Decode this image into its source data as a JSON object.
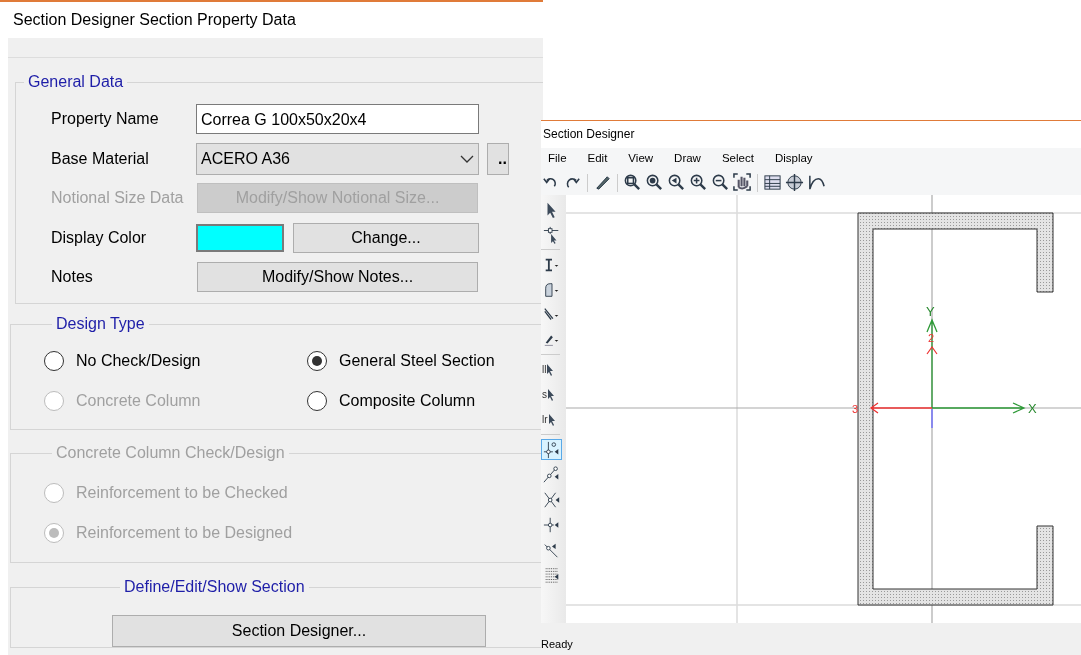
{
  "property_dialog": {
    "title": "Section Designer Section Property Data",
    "general_data": {
      "legend": "General Data",
      "rows": [
        {
          "kind": "text",
          "label": "Property Name",
          "value": "Correa G 100x50x20x4",
          "disabled": false
        },
        {
          "kind": "select",
          "label": "Base Material",
          "value": "ACERO A36",
          "disabled": false,
          "side_button": ".."
        },
        {
          "kind": "button",
          "label": "Notional Size Data",
          "button": "Modify/Show Notional Size...",
          "disabled": true
        },
        {
          "kind": "color",
          "label": "Display Color",
          "color": "#00ffff",
          "button": "Change...",
          "disabled": false
        },
        {
          "kind": "button",
          "label": "Notes",
          "button": "Modify/Show Notes...",
          "disabled": false
        }
      ]
    },
    "design_type": {
      "legend": "Design Type",
      "options": [
        {
          "label": "No Check/Design",
          "selected": false,
          "disabled": false
        },
        {
          "label": "General Steel Section",
          "selected": true,
          "disabled": false
        },
        {
          "label": "Concrete Column",
          "selected": false,
          "disabled": true
        },
        {
          "label": "Composite Column",
          "selected": false,
          "disabled": false
        }
      ]
    },
    "concrete_check": {
      "legend": "Concrete Column Check/Design",
      "disabled": true,
      "options": [
        {
          "label": "Reinforcement to be Checked",
          "selected": false,
          "disabled": true
        },
        {
          "label": "Reinforcement to be Designed",
          "selected": true,
          "disabled": true
        }
      ]
    },
    "define_section": {
      "legend": "Define/Edit/Show Section",
      "button": "Section Designer..."
    }
  },
  "designer_window": {
    "title": "Section Designer",
    "menu": [
      "File",
      "Edit",
      "View",
      "Draw",
      "Select",
      "Display"
    ],
    "side_tools": [
      {
        "kind": "pointer",
        "selected": false
      },
      {
        "kind": "reshape",
        "selected": false
      },
      {
        "kind": "divider"
      },
      {
        "kind": "frame",
        "selected": false
      },
      {
        "kind": "shape",
        "selected": false
      },
      {
        "kind": "line",
        "selected": false
      },
      {
        "kind": "pen",
        "selected": false
      },
      {
        "kind": "divider"
      },
      {
        "kind": "select-label",
        "label": "ll",
        "selected": false
      },
      {
        "kind": "select-label",
        "label": "s",
        "selected": false
      },
      {
        "kind": "select-label",
        "label": "lr",
        "selected": false
      },
      {
        "kind": "divider"
      },
      {
        "kind": "snap-point",
        "selected": true
      },
      {
        "kind": "snap-line",
        "selected": false
      },
      {
        "kind": "snap-cross",
        "selected": false
      },
      {
        "kind": "snap-mid",
        "selected": false
      },
      {
        "kind": "snap-end",
        "selected": false
      },
      {
        "kind": "grid",
        "selected": false
      }
    ],
    "canvas": {
      "axis_y": "Y",
      "axis_x": "X",
      "local_2": "2",
      "local_3": "3"
    },
    "status_bar": "Ready"
  }
}
